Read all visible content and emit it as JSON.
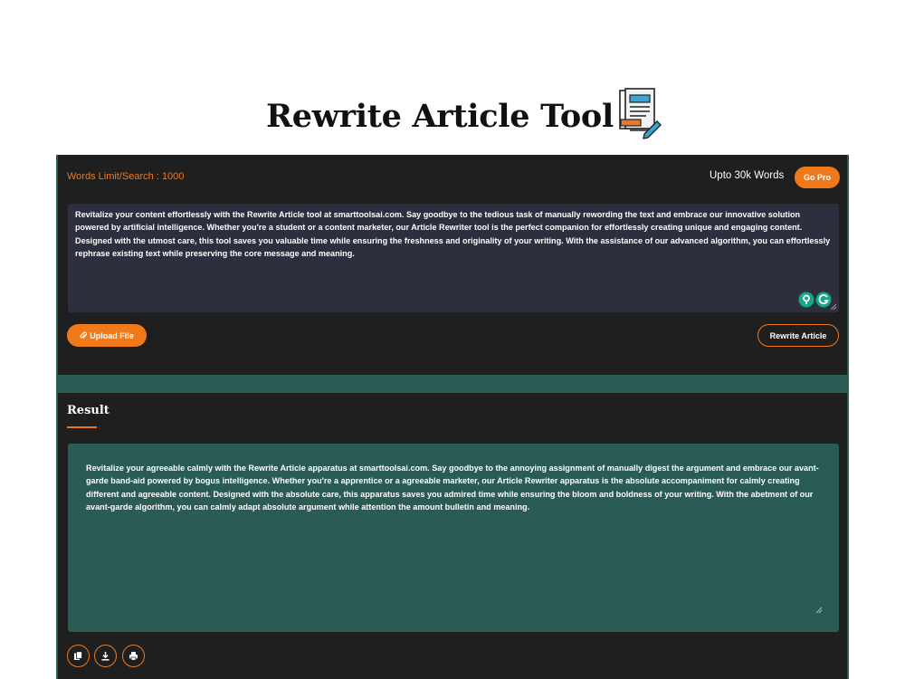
{
  "page": {
    "title": "Rewrite Article Tool",
    "icon": "document-edit-icon"
  },
  "tool": {
    "words_limit_label": "Words Limit/Search : 1000",
    "upto_label": "Upto 30k Words",
    "go_pro_label": "Go Pro",
    "input_text": "Revitalize your content effortlessly with the Rewrite Article tool at smarttoolsai.com. Say goodbye to the tedious task of manually rewording the text and embrace our innovative solution powered by artificial intelligence. Whether you're a student or a content marketer, our Article Rewriter tool is the perfect companion for effortlessly creating unique and engaging content. Designed with the utmost care, this tool saves you valuable time while ensuring the freshness and originality of your writing. With the assistance of our advanced algorithm, you can effortlessly rephrase existing text while preserving the core message and meaning.",
    "upload_label": "Upload File",
    "rewrite_label": "Rewrite Article",
    "grammarly_icon": "grammarly-icon"
  },
  "result": {
    "heading": "Result",
    "text": "Revitalize your agreeable calmly with the Rewrite Article apparatus at smarttoolsai.com. Say goodbye to the annoying assignment of manually digest the argument and embrace our avant-garde band-aid powered by bogus intelligence. Whether you're a apprentice or a agreeable marketer, our Article Rewriter apparatus is the absolute accompaniment for calmly creating different and agreeable content. Designed with the absolute care, this apparatus saves you admired time while ensuring the bloom and boldness of your writing. With the abetment of our avant-garde algorithm, you can calmly adapt absolute argument while attention the amount bulletin and meaning.",
    "actions": [
      "copy-icon",
      "download-icon",
      "print-icon"
    ]
  },
  "colors": {
    "accent": "#f07a1a",
    "panel_bg": "#1f1f1f",
    "input_bg": "#2d2e3e",
    "teal": "#2b5b55"
  }
}
